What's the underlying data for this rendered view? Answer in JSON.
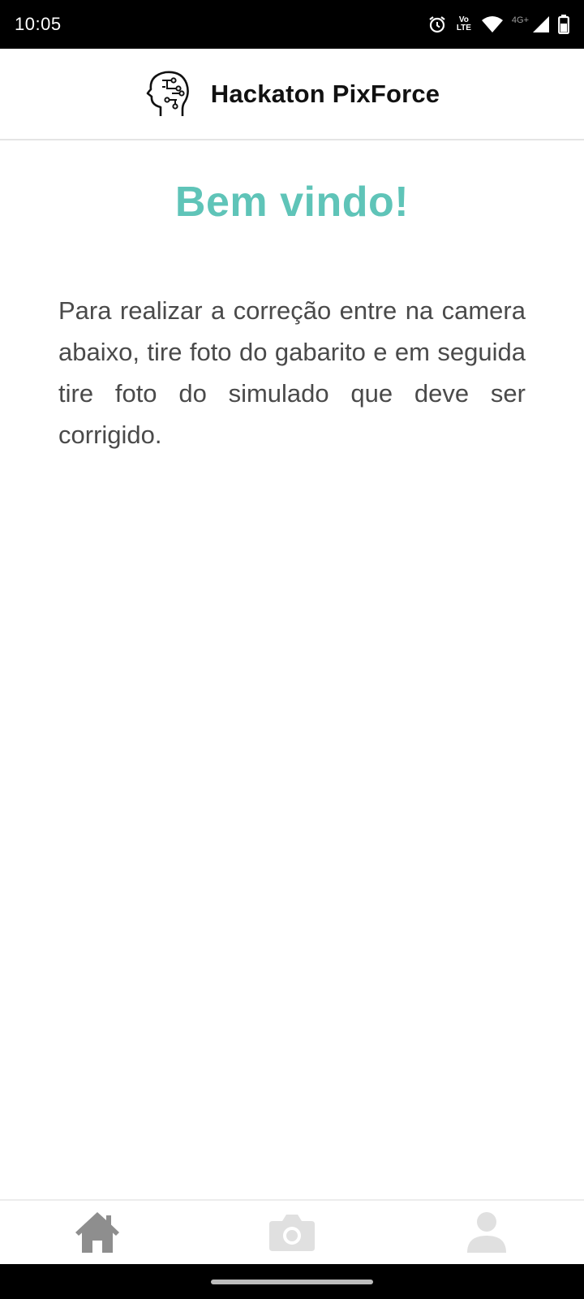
{
  "status_bar": {
    "time": "10:05",
    "volte_label": "Vo LTE",
    "network_label": "4G+",
    "icons": [
      "alarm-icon",
      "volte-icon",
      "wifi-icon",
      "signal-icon",
      "battery-icon"
    ]
  },
  "header": {
    "title": "Hackaton PixForce",
    "logo_icon": "brain-circuit-head-icon"
  },
  "main": {
    "welcome": "Bem vindo!",
    "instructions": "Para realizar a correção entre na camera abaixo, tire foto do gabarito e em seguida tire foto do simulado que deve ser corrigido."
  },
  "bottom_nav": {
    "items": [
      {
        "icon": "home-icon",
        "active": true
      },
      {
        "icon": "camera-icon",
        "active": false
      },
      {
        "icon": "user-icon",
        "active": false
      }
    ]
  },
  "colors": {
    "accent": "#5fc4b8",
    "text": "#4a4a4a",
    "nav_active": "#8e8e8e",
    "nav_inactive": "#e0e0e0"
  }
}
